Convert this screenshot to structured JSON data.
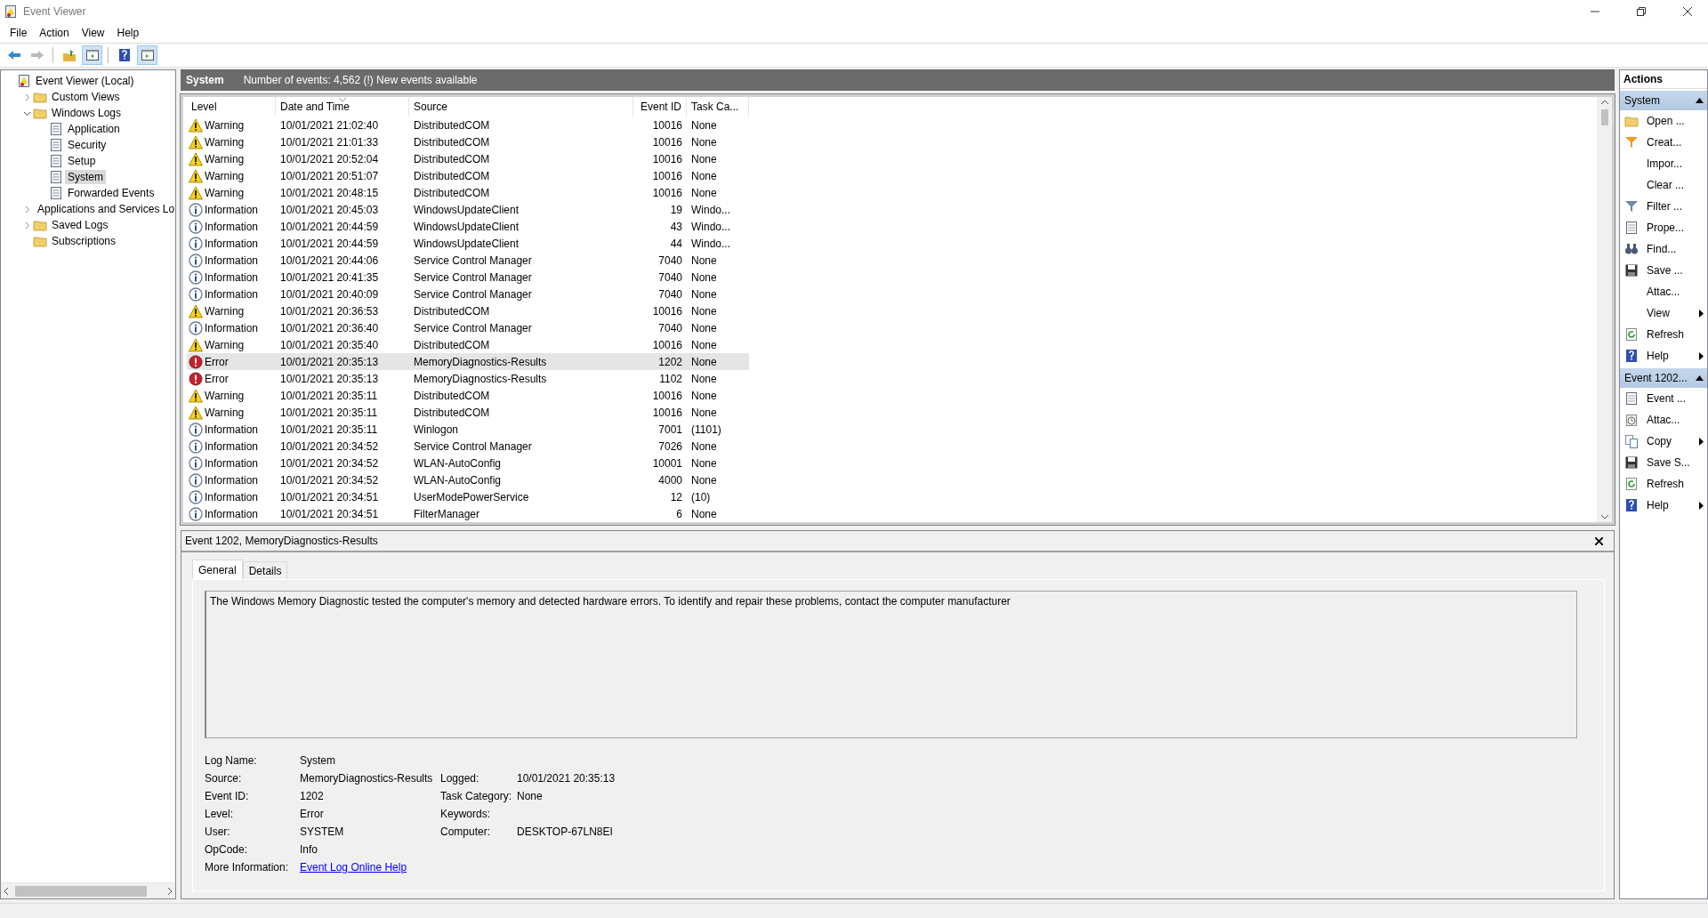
{
  "window": {
    "title": "Event Viewer"
  },
  "menu": [
    "File",
    "Action",
    "View",
    "Help"
  ],
  "toolbar": [
    {
      "pressed": false,
      "disabled": false
    },
    {
      "pressed": false,
      "disabled": true
    },
    {
      "pressed": false,
      "disabled": false
    },
    {
      "pressed": true,
      "disabled": false
    },
    {
      "pressed": false,
      "disabled": false
    },
    {
      "pressed": true,
      "disabled": false
    }
  ],
  "tree": [
    {
      "label": "Event Viewer (Local)",
      "selected": false,
      "children": [
        {
          "label": "Custom Views",
          "selected": false,
          "expanded": false
        },
        {
          "label": "Windows Logs",
          "selected": false,
          "expanded": true,
          "children": [
            {
              "label": "Application",
              "selected": false
            },
            {
              "label": "Security",
              "selected": false
            },
            {
              "label": "Setup",
              "selected": false
            },
            {
              "label": "System",
              "selected": true
            },
            {
              "label": "Forwarded Events",
              "selected": false
            }
          ]
        },
        {
          "label": "Applications and Services Lo",
          "selected": false,
          "expanded": false
        },
        {
          "label": "Saved Logs",
          "selected": false,
          "expanded": false
        },
        {
          "label": "Subscriptions",
          "selected": false
        }
      ]
    }
  ],
  "header": {
    "title": "System",
    "summary": "Number of events: 4,562 (!) New events available"
  },
  "table": {
    "columns": [
      {
        "label": "Level",
        "sorted": false
      },
      {
        "label": "Date and Time",
        "sorted": true
      },
      {
        "label": "Source",
        "sorted": false
      },
      {
        "label": "Event ID",
        "sorted": false
      },
      {
        "label": "Task Ca...",
        "sorted": false
      }
    ],
    "rows": [
      {
        "kind": "warning",
        "level": "Warning",
        "date": "10/01/2021 21:02:40",
        "source": "DistributedCOM",
        "event_id": "10016",
        "task_category": "None",
        "selected": false
      },
      {
        "kind": "warning",
        "level": "Warning",
        "date": "10/01/2021 21:01:33",
        "source": "DistributedCOM",
        "event_id": "10016",
        "task_category": "None",
        "selected": false
      },
      {
        "kind": "warning",
        "level": "Warning",
        "date": "10/01/2021 20:52:04",
        "source": "DistributedCOM",
        "event_id": "10016",
        "task_category": "None",
        "selected": false
      },
      {
        "kind": "warning",
        "level": "Warning",
        "date": "10/01/2021 20:51:07",
        "source": "DistributedCOM",
        "event_id": "10016",
        "task_category": "None",
        "selected": false
      },
      {
        "kind": "warning",
        "level": "Warning",
        "date": "10/01/2021 20:48:15",
        "source": "DistributedCOM",
        "event_id": "10016",
        "task_category": "None",
        "selected": false
      },
      {
        "kind": "information",
        "level": "Information",
        "date": "10/01/2021 20:45:03",
        "source": "WindowsUpdateClient",
        "event_id": "19",
        "task_category": "Windo...",
        "selected": false
      },
      {
        "kind": "information",
        "level": "Information",
        "date": "10/01/2021 20:44:59",
        "source": "WindowsUpdateClient",
        "event_id": "43",
        "task_category": "Windo...",
        "selected": false
      },
      {
        "kind": "information",
        "level": "Information",
        "date": "10/01/2021 20:44:59",
        "source": "WindowsUpdateClient",
        "event_id": "44",
        "task_category": "Windo...",
        "selected": false
      },
      {
        "kind": "information",
        "level": "Information",
        "date": "10/01/2021 20:44:06",
        "source": "Service Control Manager",
        "event_id": "7040",
        "task_category": "None",
        "selected": false
      },
      {
        "kind": "information",
        "level": "Information",
        "date": "10/01/2021 20:41:35",
        "source": "Service Control Manager",
        "event_id": "7040",
        "task_category": "None",
        "selected": false
      },
      {
        "kind": "information",
        "level": "Information",
        "date": "10/01/2021 20:40:09",
        "source": "Service Control Manager",
        "event_id": "7040",
        "task_category": "None",
        "selected": false
      },
      {
        "kind": "warning",
        "level": "Warning",
        "date": "10/01/2021 20:36:53",
        "source": "DistributedCOM",
        "event_id": "10016",
        "task_category": "None",
        "selected": false
      },
      {
        "kind": "information",
        "level": "Information",
        "date": "10/01/2021 20:36:40",
        "source": "Service Control Manager",
        "event_id": "7040",
        "task_category": "None",
        "selected": false
      },
      {
        "kind": "warning",
        "level": "Warning",
        "date": "10/01/2021 20:35:40",
        "source": "DistributedCOM",
        "event_id": "10016",
        "task_category": "None",
        "selected": false
      },
      {
        "kind": "error",
        "level": "Error",
        "date": "10/01/2021 20:35:13",
        "source": "MemoryDiagnostics-Results",
        "event_id": "1202",
        "task_category": "None",
        "selected": true
      },
      {
        "kind": "error",
        "level": "Error",
        "date": "10/01/2021 20:35:13",
        "source": "MemoryDiagnostics-Results",
        "event_id": "1102",
        "task_category": "None",
        "selected": false
      },
      {
        "kind": "warning",
        "level": "Warning",
        "date": "10/01/2021 20:35:11",
        "source": "DistributedCOM",
        "event_id": "10016",
        "task_category": "None",
        "selected": false
      },
      {
        "kind": "warning",
        "level": "Warning",
        "date": "10/01/2021 20:35:11",
        "source": "DistributedCOM",
        "event_id": "10016",
        "task_category": "None",
        "selected": false
      },
      {
        "kind": "information",
        "level": "Information",
        "date": "10/01/2021 20:35:11",
        "source": "Winlogon",
        "event_id": "7001",
        "task_category": "(1101)",
        "selected": false
      },
      {
        "kind": "information",
        "level": "Information",
        "date": "10/01/2021 20:34:52",
        "source": "Service Control Manager",
        "event_id": "7026",
        "task_category": "None",
        "selected": false
      },
      {
        "kind": "information",
        "level": "Information",
        "date": "10/01/2021 20:34:52",
        "source": "WLAN-AutoConfig",
        "event_id": "10001",
        "task_category": "None",
        "selected": false
      },
      {
        "kind": "information",
        "level": "Information",
        "date": "10/01/2021 20:34:52",
        "source": "WLAN-AutoConfig",
        "event_id": "4000",
        "task_category": "None",
        "selected": false
      },
      {
        "kind": "information",
        "level": "Information",
        "date": "10/01/2021 20:34:51",
        "source": "UserModePowerService",
        "event_id": "12",
        "task_category": "(10)",
        "selected": false
      },
      {
        "kind": "information",
        "level": "Information",
        "date": "10/01/2021 20:34:51",
        "source": "FilterManager",
        "event_id": "6",
        "task_category": "None",
        "selected": false
      }
    ]
  },
  "detail": {
    "title": "Event 1202, MemoryDiagnostics-Results",
    "tabs": [
      {
        "label": "General",
        "selected": true
      },
      {
        "label": "Details",
        "selected": false
      }
    ],
    "description": "The Windows Memory Diagnostic tested the computer's memory and detected hardware errors. To identify and repair these problems, contact the computer manufacturer",
    "fields": [
      [
        {
          "label": "Log Name:",
          "value": "System"
        }
      ],
      [
        {
          "label": "Source:",
          "value": "MemoryDiagnostics-Results"
        },
        {
          "label": "Logged:",
          "value": "10/01/2021 20:35:13"
        }
      ],
      [
        {
          "label": "Event ID:",
          "value": "1202"
        },
        {
          "label": "Task Category:",
          "value": "None"
        }
      ],
      [
        {
          "label": "Level:",
          "value": "Error"
        },
        {
          "label": "Keywords:"
        }
      ],
      [
        {
          "label": "User:",
          "value": "SYSTEM"
        },
        {
          "label": "Computer:",
          "value": "DESKTOP-67LN8EI"
        }
      ],
      [
        {
          "label": "OpCode:",
          "value": "Info"
        }
      ],
      [
        {
          "label": "More Information:",
          "link": "Event Log Online Help"
        }
      ]
    ]
  },
  "actions": {
    "title": "Actions",
    "sections": [
      {
        "title": "System",
        "expanded": true,
        "items": [
          {
            "label": "Open ...",
            "submenu": false
          },
          {
            "label": "Creat...",
            "submenu": false
          },
          {
            "label": "Impor...",
            "submenu": false
          },
          {
            "label": "Clear ...",
            "submenu": false
          },
          {
            "label": "Filter ...",
            "submenu": false
          },
          {
            "label": "Prope...",
            "submenu": false
          },
          {
            "label": "Find...",
            "submenu": false
          },
          {
            "label": "Save ...",
            "submenu": false
          },
          {
            "label": "Attac...",
            "submenu": false
          },
          {
            "label": "View",
            "submenu": true
          },
          {
            "label": "Refresh",
            "submenu": false
          },
          {
            "label": "Help",
            "submenu": true
          }
        ]
      },
      {
        "title": "Event 1202...",
        "expanded": true,
        "items": [
          {
            "label": "Event ...",
            "submenu": false
          },
          {
            "label": "Attac...",
            "submenu": false
          },
          {
            "label": "Copy",
            "submenu": true
          },
          {
            "label": "Save S...",
            "submenu": false
          },
          {
            "label": "Refresh",
            "submenu": false
          },
          {
            "label": "Help",
            "submenu": true
          }
        ]
      }
    ]
  }
}
